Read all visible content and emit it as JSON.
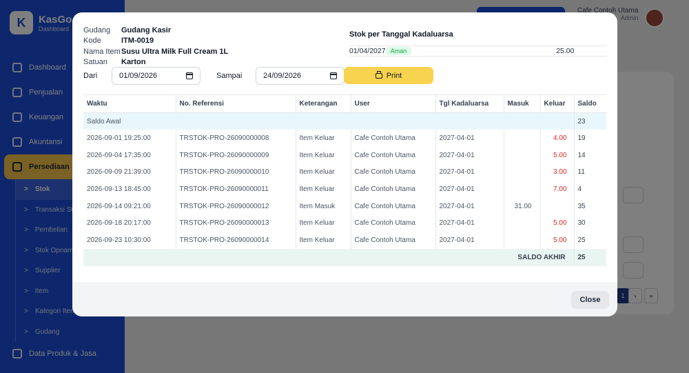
{
  "app": {
    "brand_name": "KasGo",
    "brand_sub": "Dashboard",
    "brand_letter": "K",
    "user_name": "Cafe Contoh Utama",
    "user_role": "Admin"
  },
  "sidebar": {
    "items": [
      {
        "label": "Dashboard",
        "icon": "grid-icon"
      },
      {
        "label": "Penjualan",
        "icon": "cart-icon"
      },
      {
        "label": "Keuangan",
        "icon": "wallet-icon"
      },
      {
        "label": "Akuntansi",
        "icon": "document-icon"
      },
      {
        "label": "Persediaan",
        "icon": "box-icon"
      }
    ],
    "subitems": [
      "Stok",
      "Transaksi Stok",
      "Pembelian",
      "Stok Opname",
      "Supplier",
      "Item",
      "Kategori Item",
      "Gudang"
    ],
    "bottom_item": "Data Produk & Jasa",
    "chevron": ">"
  },
  "background": {
    "more_label": "...",
    "pagination": {
      "current": "1",
      "next": "›",
      "last": "»"
    }
  },
  "modal": {
    "info": {
      "gudang_label": "Gudang",
      "gudang_value": "Gudang Kasir",
      "kode_label": "Kode",
      "kode_value": "ITM-0019",
      "nama_label": "Nama Item",
      "nama_value": "Susu Ultra Milk Full Cream 1L",
      "satuan_label": "Satuan",
      "satuan_value": "Karton"
    },
    "expiry": {
      "title": "Stok per Tanggal Kadaluarsa",
      "date": "01/04/2027",
      "badge": "Aman",
      "qty": "25.00"
    },
    "filter": {
      "dari_label": "Dari",
      "dari_value": "01/09/2026",
      "sampai_label": "Sampai",
      "sampai_value": "24/09/2026",
      "print_label": "Print"
    },
    "table": {
      "headers": [
        "Waktu",
        "No. Referensi",
        "Keterangan",
        "User",
        "Tgl Kadaluarsa",
        "Masuk",
        "Keluar",
        "Saldo"
      ],
      "saldo_awal_label": "Saldo Awal",
      "saldo_awal_value": "23",
      "rows": [
        {
          "waktu": "2026-09-01 19:25:00",
          "ref": "TRSTOK-PRO-26090000008",
          "ket": "Item Keluar",
          "user": "Cafe Contoh Utama",
          "exp": "2027-04-01",
          "masuk": "",
          "keluar": "4.00",
          "saldo": "19"
        },
        {
          "waktu": "2026-09-04 17:35:00",
          "ref": "TRSTOK-PRO-26090000009",
          "ket": "Item Keluar",
          "user": "Cafe Contoh Utama",
          "exp": "2027-04-01",
          "masuk": "",
          "keluar": "5.00",
          "saldo": "14"
        },
        {
          "waktu": "2026-09-09 21:39:00",
          "ref": "TRSTOK-PRO-26090000010",
          "ket": "Item Keluar",
          "user": "Cafe Contoh Utama",
          "exp": "2027-04-01",
          "masuk": "",
          "keluar": "3.00",
          "saldo": "11"
        },
        {
          "waktu": "2026-09-13 18:45:00",
          "ref": "TRSTOK-PRO-26090000011",
          "ket": "Item Keluar",
          "user": "Cafe Contoh Utama",
          "exp": "2027-04-01",
          "masuk": "",
          "keluar": "7.00",
          "saldo": "4"
        },
        {
          "waktu": "2026-09-14 09:21:00",
          "ref": "TRSTOK-PRO-26090000012",
          "ket": "Item Masuk",
          "user": "Cafe Contoh Utama",
          "exp": "2027-04-01",
          "masuk": "31.00",
          "keluar": "",
          "saldo": "35"
        },
        {
          "waktu": "2026-09-18 20:17:00",
          "ref": "TRSTOK-PRO-26090000013",
          "ket": "Item Keluar",
          "user": "Cafe Contoh Utama",
          "exp": "2027-04-01",
          "masuk": "",
          "keluar": "5.00",
          "saldo": "30"
        },
        {
          "waktu": "2026-09-23 10:30:00",
          "ref": "TRSTOK-PRO-26090000014",
          "ket": "Item Keluar",
          "user": "Cafe Contoh Utama",
          "exp": "2027-04-01",
          "masuk": "",
          "keluar": "5.00",
          "saldo": "25"
        }
      ],
      "saldo_akhir_label": "SALDO AKHIR",
      "saldo_akhir_value": "25"
    },
    "close_label": "Close"
  },
  "colors": {
    "primary": "#1d4ed8",
    "accent": "#f8d34f",
    "danger": "#dc2626",
    "success": "#16a34a"
  }
}
